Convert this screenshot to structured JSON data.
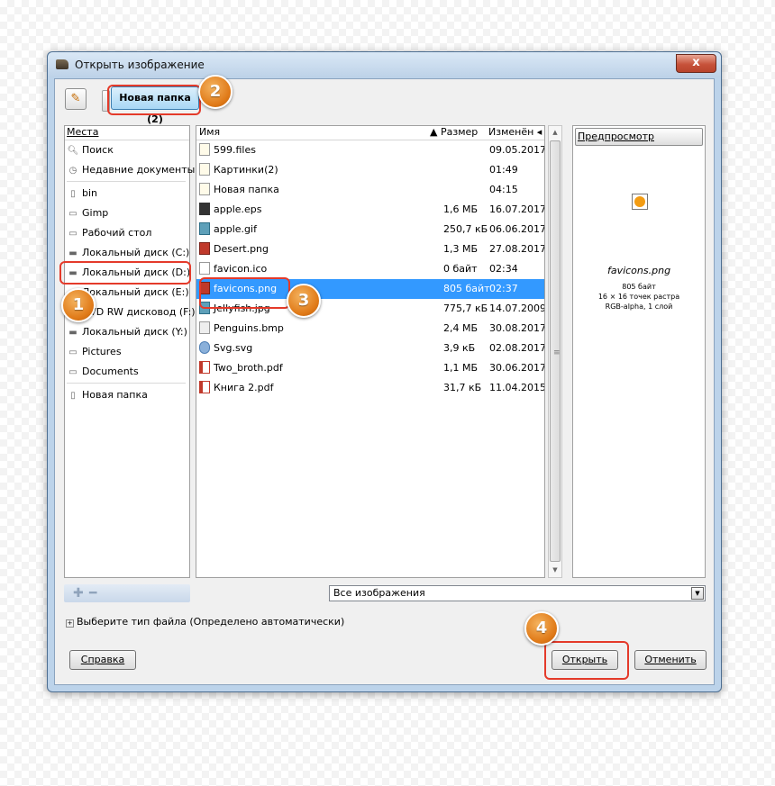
{
  "window": {
    "title": "Открыть изображение",
    "close_label": "x"
  },
  "pathbar": {
    "current_folder": "Новая папка (2)"
  },
  "places": {
    "header": "Места",
    "items": [
      {
        "label": "Поиск",
        "icon": "search-icon"
      },
      {
        "label": "Недавние документы",
        "icon": "recent-icon"
      },
      {
        "label": "bin",
        "icon": "file-icon"
      },
      {
        "label": "Gimp",
        "icon": "folder-icon"
      },
      {
        "label": "Рабочий стол",
        "icon": "folder-icon"
      },
      {
        "label": "Локальный диск (C:)",
        "icon": "drive-icon"
      },
      {
        "label": "Локальный диск (D:)",
        "icon": "drive-icon"
      },
      {
        "label": "Локальный диск (E:)",
        "icon": "drive-icon"
      },
      {
        "label": "DVD RW дисковод (F:)",
        "icon": "optical-drive-icon"
      },
      {
        "label": "Локальный диск (Y:)",
        "icon": "drive-icon"
      },
      {
        "label": "Pictures",
        "icon": "folder-icon"
      },
      {
        "label": "Documents",
        "icon": "folder-icon"
      },
      {
        "label": "Новая папка",
        "icon": "file-icon"
      }
    ]
  },
  "files": {
    "columns": {
      "name": "Имя",
      "size": "Размер",
      "modified": "Изменён"
    },
    "rows": [
      {
        "name": "599.files",
        "size": "",
        "date": "09.05.2017",
        "icon": "folder"
      },
      {
        "name": "Картинки(2)",
        "size": "",
        "date": "01:49",
        "icon": "folder"
      },
      {
        "name": "Новая папка",
        "size": "",
        "date": "04:15",
        "icon": "folder"
      },
      {
        "name": "apple.eps",
        "size": "1,6 МБ",
        "date": "16.07.2017",
        "icon": "eps"
      },
      {
        "name": "apple.gif",
        "size": "250,7 кБ",
        "date": "06.06.2017",
        "icon": "gif"
      },
      {
        "name": "Desert.png",
        "size": "1,3 МБ",
        "date": "27.08.2017",
        "icon": "png"
      },
      {
        "name": "favicon.ico",
        "size": "0 байт",
        "date": "02:34",
        "icon": "file"
      },
      {
        "name": "favicons.png",
        "size": "805 байт",
        "date": "02:37",
        "icon": "png",
        "selected": true
      },
      {
        "name": "Jellyfish.jpg",
        "size": "775,7 кБ",
        "date": "14.07.2009",
        "icon": "gif"
      },
      {
        "name": "Penguins.bmp",
        "size": "2,4 МБ",
        "date": "30.08.2017",
        "icon": "bmp"
      },
      {
        "name": "Svg.svg",
        "size": "3,9 кБ",
        "date": "02.08.2017",
        "icon": "svg"
      },
      {
        "name": "Two_broth.pdf",
        "size": "1,1 МБ",
        "date": "30.06.2017",
        "icon": "pdf"
      },
      {
        "name": "Книга 2.pdf",
        "size": "31,7 кБ",
        "date": "11.04.2015",
        "icon": "pdf"
      }
    ]
  },
  "preview": {
    "button_label": "Предпросмотр",
    "filename": "favicons.png",
    "size": "805 байт",
    "dimensions": "16 × 16 точек растра",
    "mode": "RGB-alpha, 1 слой"
  },
  "filter": {
    "selected": "Все изображения"
  },
  "filetype_expander": "Выберите тип файла (Определено автоматически)",
  "buttons": {
    "help": "Справка",
    "open": "Открыть",
    "cancel": "Отменить"
  },
  "annotations": {
    "step1": "1",
    "step2": "2",
    "step3": "3",
    "step4": "4",
    "highlight_color": "#e43a2a",
    "badge_color": "#e07a18"
  }
}
